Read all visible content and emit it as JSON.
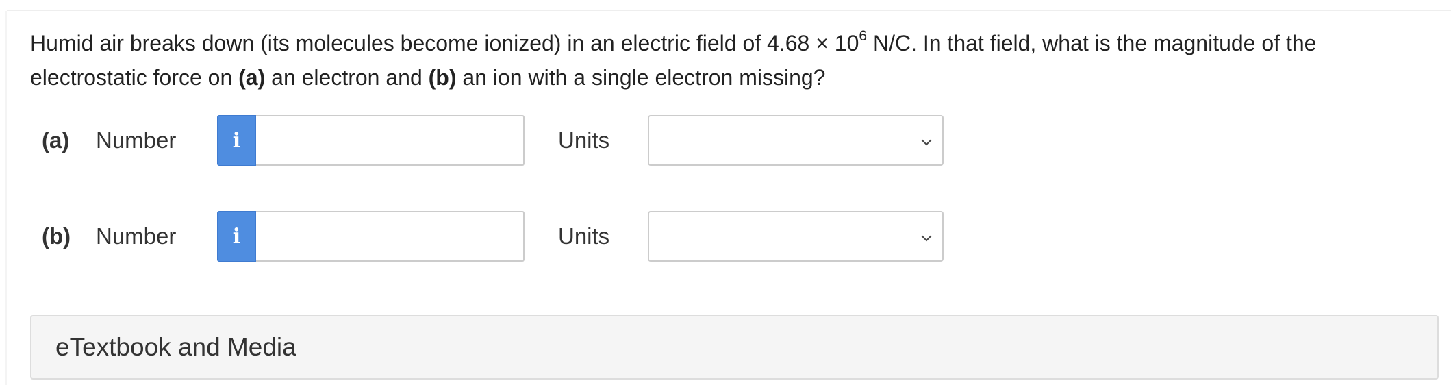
{
  "question": {
    "text_before_exponent": "Humid air breaks down (its molecules become ionized) in an electric field of 4.68 × 10",
    "exponent": "6",
    "text_after_exponent": " N/C. In that field, what is the magnitude of the electrostatic force on ",
    "part_a_marker": "(a)",
    "text_part_a": " an electron and ",
    "part_b_marker": "(b)",
    "text_part_b": " an ion with a single electron missing?"
  },
  "parts": [
    {
      "label": "(a)",
      "number_label": "Number",
      "info_icon": "i",
      "number_value": "",
      "units_label": "Units",
      "units_selected": ""
    },
    {
      "label": "(b)",
      "number_label": "Number",
      "info_icon": "i",
      "number_value": "",
      "units_label": "Units",
      "units_selected": ""
    }
  ],
  "media": {
    "title": "eTextbook and Media"
  },
  "colors": {
    "info_button": "#4f8de0",
    "border": "#cccccc",
    "media_bar_bg": "#f5f5f5",
    "text": "#222222"
  }
}
